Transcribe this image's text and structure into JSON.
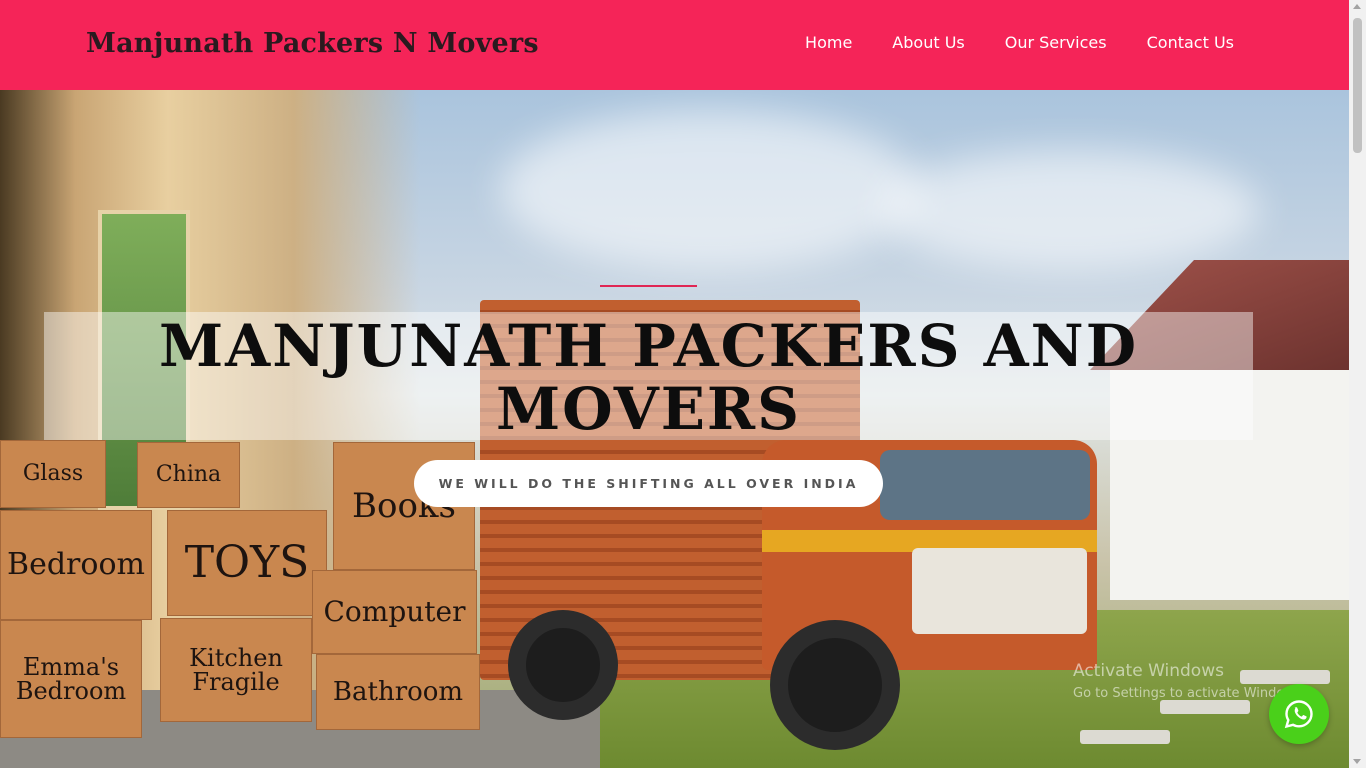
{
  "brand": {
    "name": "Manjunath Packers N Movers"
  },
  "nav": {
    "items": [
      {
        "label": "Home"
      },
      {
        "label": "About Us"
      },
      {
        "label": "Our Services"
      },
      {
        "label": "Contact Us"
      }
    ]
  },
  "hero": {
    "title": "MANJUNATH PACKERS AND MOVERS",
    "button_label": "WE WILL DO THE SHIFTING ALL OVER INDIA",
    "box_labels": [
      "Glass",
      "China",
      "Books",
      "Bedroom",
      "TOYS",
      "Computer",
      "Emma's Bedroom",
      "Kitchen Fragile",
      "Bathroom"
    ]
  },
  "watermark": {
    "title": "Activate Windows",
    "subtitle": "Go to Settings to activate Windows."
  },
  "icons": {
    "whatsapp": "whatsapp-icon"
  },
  "colors": {
    "accent": "#f52458",
    "whatsapp": "#4ad01a"
  }
}
